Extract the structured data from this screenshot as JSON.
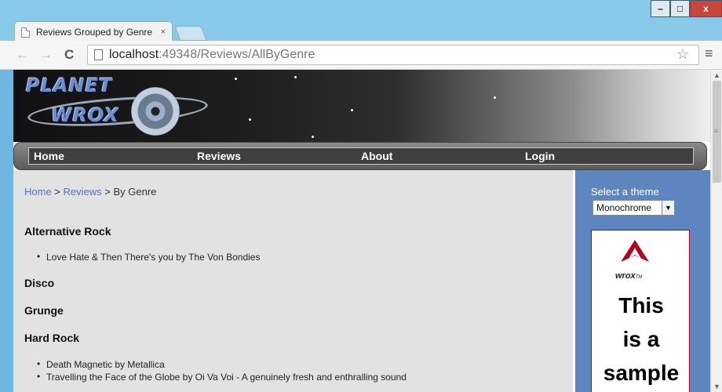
{
  "browser": {
    "tab_title": "Reviews Grouped by Genre",
    "tab_close": "×",
    "url_host": "localhost",
    "url_path": ":49348/Reviews/AllByGenre",
    "window_buttons": {
      "minimize": "–",
      "maximize": "□",
      "close": "x"
    },
    "nav_icons": {
      "back": "←",
      "forward": "→",
      "reload": "C"
    },
    "star": "☆",
    "menu": "≡"
  },
  "site": {
    "logo": {
      "line1": "PLANET",
      "line2": "WROX"
    },
    "menu": [
      {
        "label": "Home"
      },
      {
        "label": "Reviews"
      },
      {
        "label": "About"
      },
      {
        "label": "Login"
      }
    ]
  },
  "breadcrumb": {
    "home": "Home",
    "sep1": " > ",
    "reviews": "Reviews",
    "sep2": " > ",
    "current": "By Genre"
  },
  "genres": [
    {
      "name": "Alternative Rock",
      "reviews": [
        "Love Hate & Then There's you by The Von Bondies"
      ]
    },
    {
      "name": "Disco",
      "reviews": []
    },
    {
      "name": "Grunge",
      "reviews": []
    },
    {
      "name": "Hard Rock",
      "reviews": [
        "Death Magnetic by Metallica",
        "Travelling the Face of the Globe by Oi Va Voi - A genuinely fresh and enthralling sound"
      ]
    }
  ],
  "sidebar": {
    "theme_label": "Select a theme",
    "theme_value": "Monochrome",
    "ad": {
      "brand": "wrox",
      "tm": "TM",
      "line1": "This",
      "line2": "is a",
      "line3": "sample"
    }
  }
}
